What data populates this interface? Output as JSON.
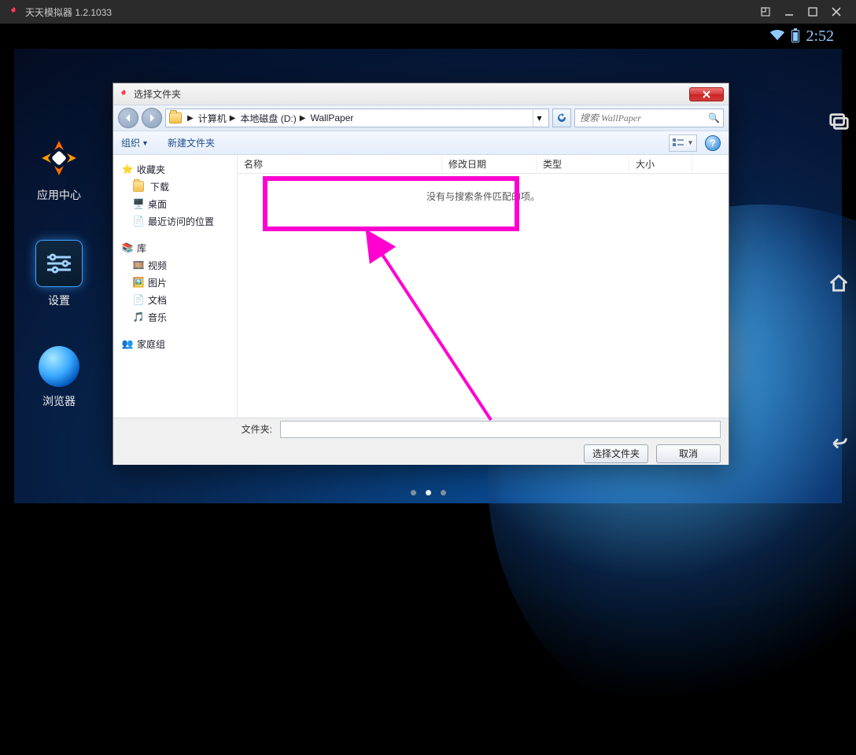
{
  "emulator": {
    "title": "天天模拟器 1.2.1033"
  },
  "statusbar": {
    "time": "2:52"
  },
  "launcher": {
    "apps": [
      {
        "label": "应用中心"
      },
      {
        "label": "设置"
      },
      {
        "label": "浏览器"
      }
    ]
  },
  "dialog": {
    "title": "选择文件夹",
    "breadcrumb": {
      "root": "计算机",
      "drive": "本地磁盘 (D:)",
      "folder": "WallPaper"
    },
    "search_placeholder": "搜索 WallPaper",
    "toolbar": {
      "organize": "组织",
      "newfolder": "新建文件夹",
      "help": "?"
    },
    "tree": {
      "favorites": "收藏夹",
      "downloads": "下载",
      "desktop": "桌面",
      "recent": "最近访问的位置",
      "library": "库",
      "video": "视频",
      "pictures": "图片",
      "docs": "文档",
      "music": "音乐",
      "homegroup": "家庭组"
    },
    "columns": {
      "name": "名称",
      "date": "修改日期",
      "type": "类型",
      "size": "大小"
    },
    "empty_msg": "没有与搜索条件匹配的项。",
    "footer": {
      "label": "文件夹:",
      "ok": "选择文件夹",
      "cancel": "取消"
    }
  }
}
